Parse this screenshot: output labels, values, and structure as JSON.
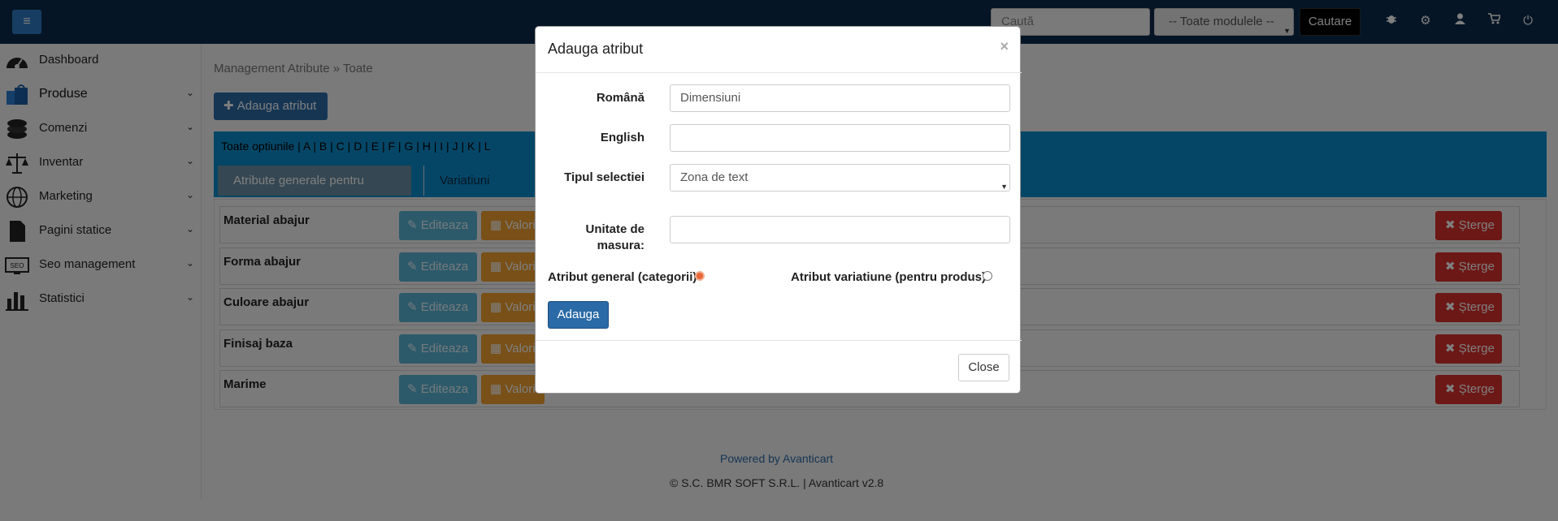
{
  "topbar": {
    "menu_icon": "hamburger-icon",
    "search_placeholder": "Caută",
    "module_select_value": "-- Toate modulele --",
    "search_button": "Cautare",
    "icons": [
      "bug-icon",
      "gear-icon",
      "user-icon",
      "cart-icon",
      "power-icon"
    ]
  },
  "sidebar": {
    "items": [
      {
        "label": "Dashboard",
        "icon": "dashboard-gauge-icon",
        "has_submenu": false
      },
      {
        "label": "Produse",
        "icon": "shopping-bags-icon",
        "has_submenu": true
      },
      {
        "label": "Comenzi",
        "icon": "coins-stack-icon",
        "has_submenu": true
      },
      {
        "label": "Inventar",
        "icon": "scales-icon",
        "has_submenu": true
      },
      {
        "label": "Marketing",
        "icon": "globe-icon",
        "has_submenu": true
      },
      {
        "label": "Pagini statice",
        "icon": "document-icon",
        "has_submenu": true
      },
      {
        "label": "Seo management",
        "icon": "seo-monitor-icon",
        "has_submenu": true
      },
      {
        "label": "Statistici",
        "icon": "bar-chart-icon",
        "has_submenu": true
      }
    ],
    "chevron": "⌄"
  },
  "main": {
    "breadcrumb": "Management Atribute » Toate",
    "add_button": "Adauga atribut",
    "letters": "Toate optiunile | A | B | C | D | E | F | G | H | I | J | K | L",
    "tabs": [
      {
        "label": "Atribute generale pentru categorie",
        "active": true
      },
      {
        "label": "Variatiuni pentru pr",
        "active": false
      }
    ],
    "rows": [
      {
        "name": "Material abajur",
        "edit": "Editeaza",
        "values": "Valori",
        "delete": "Sterge"
      },
      {
        "name": "Forma abajur",
        "edit": "Editeaza",
        "values": "Valori",
        "delete": "Sterge"
      },
      {
        "name": "Culoare abajur",
        "edit": "Editeaza",
        "values": "Valori",
        "delete": "Sterge"
      },
      {
        "name": "Finisaj baza",
        "edit": "Editeaza",
        "values": "Valori",
        "delete": "Sterge"
      },
      {
        "name": "Marime",
        "edit": "Editeaza",
        "values": "Valori",
        "delete": "Sterge"
      }
    ],
    "delete_label": "Șterge"
  },
  "footer": {
    "powered_by": "Powered by Avanticart",
    "copyright": "© S.C. BMR SOFT S.R.L. | Avanticart v2.8"
  },
  "modal": {
    "title": "Adauga atribut",
    "close_x": "×",
    "fields": {
      "romana_label": "Română",
      "romana_value": "Dimensiuni",
      "english_label": "English",
      "english_value": "",
      "tip_label": "Tipul selectiei",
      "tip_value": "Zona de text",
      "unitate_label_1": "Unitate de",
      "unitate_label_2": "masura:",
      "unitate_value": ""
    },
    "radio_general": "Atribut general (categorii)",
    "radio_variatiune": "Atribut variatiune (pentru produs)",
    "radio_selected": "general",
    "submit": "Adauga",
    "close_button": "Close"
  }
}
